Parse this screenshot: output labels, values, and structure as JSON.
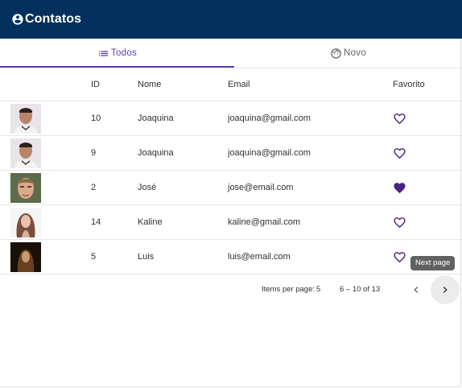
{
  "toolbar": {
    "title": "Contatos",
    "logo_icon": "account-circle-icon"
  },
  "tabs": [
    {
      "label": "Todos",
      "icon": "list-icon",
      "active": true
    },
    {
      "label": "Novo",
      "icon": "face-icon",
      "active": false
    }
  ],
  "table": {
    "headers": {
      "id": "ID",
      "nome": "Nome",
      "email": "Email",
      "favorito": "Favorito"
    },
    "rows": [
      {
        "id": "10",
        "nome": "Joaquina",
        "email": "joaquina@gmail.com",
        "favorito": false
      },
      {
        "id": "9",
        "nome": "Joaquina",
        "email": "joaquina@gmail.com",
        "favorito": false
      },
      {
        "id": "2",
        "nome": "José",
        "email": "jose@email.com",
        "favorito": true
      },
      {
        "id": "14",
        "nome": "Kaline",
        "email": "kaline@gmail.com",
        "favorito": false
      },
      {
        "id": "5",
        "nome": "Luis",
        "email": "luis@email.com",
        "favorito": false
      }
    ]
  },
  "paginator": {
    "items_per_page_label": "Items per page:",
    "page_size": "5",
    "range_label": "6 – 10 of 13",
    "next_tooltip": "Next page"
  },
  "colors": {
    "toolbar": "#04305d",
    "accent": "#5a3ea8",
    "heart": "#4a2480"
  }
}
